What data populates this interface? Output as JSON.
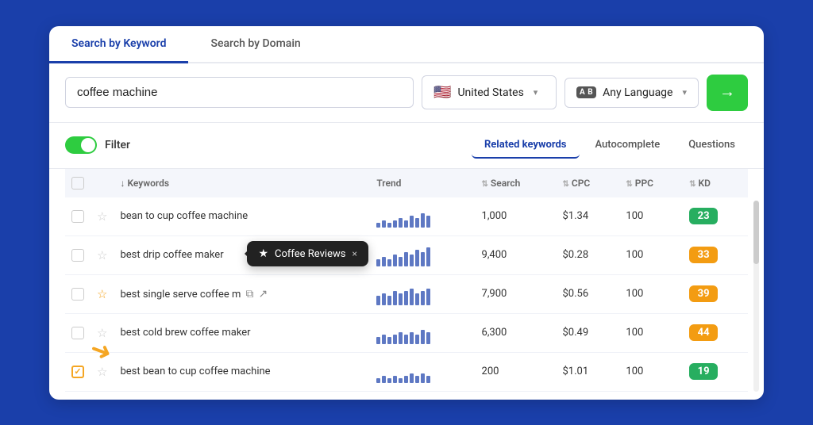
{
  "tabs": [
    {
      "label": "Search by Keyword",
      "active": true
    },
    {
      "label": "Search by Domain",
      "active": false
    }
  ],
  "search": {
    "keyword_value": "coffee machine",
    "country_flag": "🇺🇸",
    "country_label": "United States",
    "lang_badge": "A B",
    "lang_label": "Any Language",
    "search_btn_icon": "→"
  },
  "filter": {
    "toggle_on": true,
    "label": "Filter"
  },
  "keyword_tabs": [
    {
      "label": "Related keywords",
      "active": true
    },
    {
      "label": "Autocomplete",
      "active": false
    },
    {
      "label": "Questions",
      "active": false
    }
  ],
  "table": {
    "headers": [
      {
        "label": "Keywords",
        "sortable": true
      },
      {
        "label": "Trend",
        "sortable": false
      },
      {
        "label": "Search",
        "sortable": true
      },
      {
        "label": "CPC",
        "sortable": true
      },
      {
        "label": "PPC",
        "sortable": true
      },
      {
        "label": "KD",
        "sortable": true
      }
    ],
    "rows": [
      {
        "id": 1,
        "checked": false,
        "starred": false,
        "keyword": "bean to cup coffee machine",
        "trend_bars": [
          2,
          3,
          2,
          3,
          4,
          3,
          5,
          4,
          6,
          5
        ],
        "search": "1,000",
        "cpc": "$1.34",
        "ppc": "100",
        "kd": "23",
        "kd_class": "kd-green",
        "has_tooltip": false,
        "has_icons": false
      },
      {
        "id": 2,
        "checked": false,
        "starred": false,
        "keyword": "best drip coffee maker",
        "trend_bars": [
          3,
          4,
          3,
          5,
          4,
          6,
          5,
          7,
          6,
          8
        ],
        "search": "9,400",
        "cpc": "$0.28",
        "ppc": "100",
        "kd": "33",
        "kd_class": "kd-orange",
        "has_tooltip": true,
        "has_icons": false
      },
      {
        "id": 3,
        "checked": false,
        "starred": true,
        "keyword": "best single serve coffee m",
        "trend_bars": [
          4,
          5,
          4,
          6,
          5,
          6,
          7,
          5,
          6,
          7
        ],
        "search": "7,900",
        "cpc": "$0.56",
        "ppc": "100",
        "kd": "39",
        "kd_class": "kd-orange",
        "has_tooltip": false,
        "has_icons": true
      },
      {
        "id": 4,
        "checked": false,
        "starred": false,
        "keyword": "best cold brew coffee maker",
        "trend_bars": [
          3,
          4,
          3,
          4,
          5,
          4,
          5,
          4,
          6,
          5
        ],
        "search": "6,300",
        "cpc": "$0.49",
        "ppc": "100",
        "kd": "44",
        "kd_class": "kd-orange",
        "has_tooltip": false,
        "has_icons": false
      },
      {
        "id": 5,
        "checked": true,
        "starred": false,
        "keyword": "best bean to cup coffee machine",
        "trend_bars": [
          2,
          3,
          2,
          3,
          2,
          3,
          4,
          3,
          4,
          3
        ],
        "search": "200",
        "cpc": "$1.01",
        "ppc": "100",
        "kd": "19",
        "kd_class": "kd-green",
        "has_tooltip": false,
        "has_icons": false
      }
    ]
  },
  "tooltip": {
    "star_icon": "★",
    "label": "Coffee Reviews",
    "close": "×"
  }
}
